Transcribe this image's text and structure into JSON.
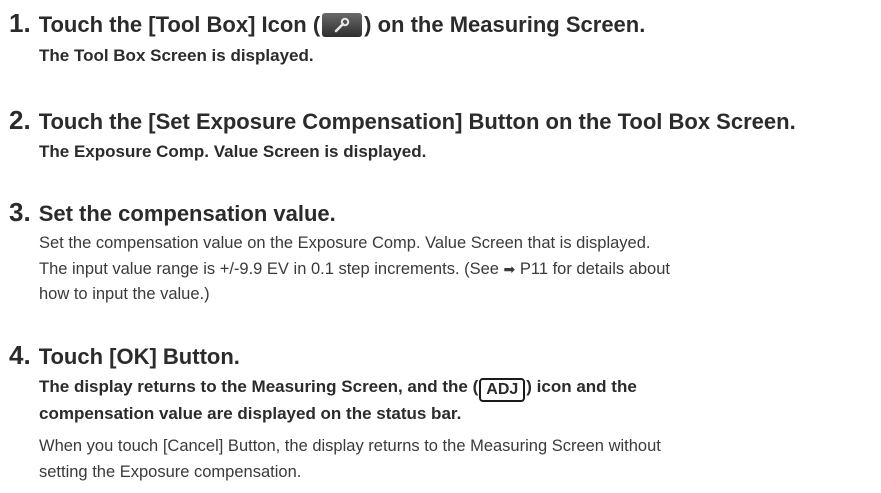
{
  "steps": [
    {
      "number": "1.",
      "title_before": "Touch the [Tool Box] Icon (",
      "title_after": ") on the Measuring Screen.",
      "result": "The Tool Box Screen is displayed."
    },
    {
      "number": "2.",
      "title": "Touch the [Set Exposure Compensation] Button on the Tool Box Screen.",
      "result": "The Exposure Comp. Value Screen is displayed."
    },
    {
      "number": "3.",
      "title": "Set the compensation value.",
      "line1": "Set the compensation value on the Exposure Comp. Value Screen that is displayed.",
      "line2_before": "The input value range is +/-9.9 EV in 0.1 step increments. (See ",
      "arrow": "➡",
      "line2_after": " P11 for details about",
      "line3": "how to input the value.)"
    },
    {
      "number": "4.",
      "title": "Touch [OK] Button.",
      "result1_before": "The display returns to the Measuring Screen, and the (",
      "adj_label": "ADJ",
      "result1_after": ") icon and the",
      "result2": "compensation value are displayed on the status bar.",
      "note1": "When you touch [Cancel] Button, the display returns to the Measuring Screen without",
      "note2": "setting the Exposure compensation."
    }
  ],
  "icons": {
    "tool_icon": "wrench-icon"
  }
}
